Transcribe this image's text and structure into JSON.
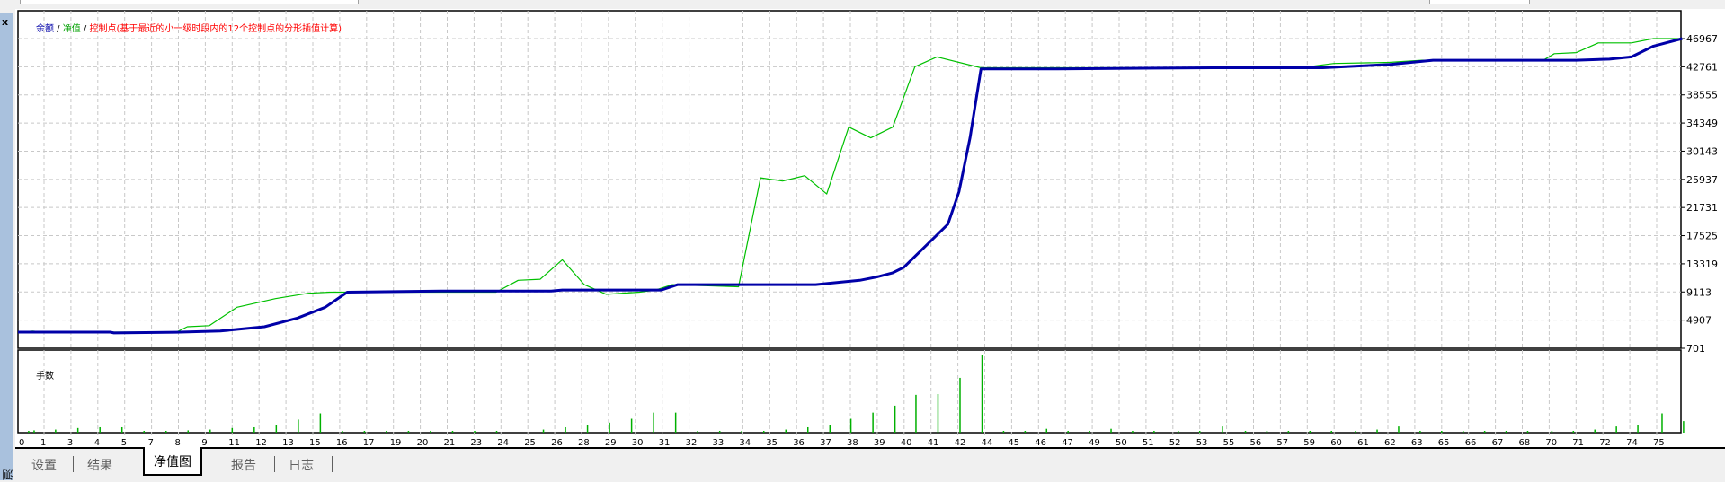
{
  "window": {
    "close_label": "x",
    "panel_label": "测试"
  },
  "legend": {
    "balance": "余额",
    "sep1": " / ",
    "equity": "净值",
    "sep2": " / ",
    "control": "控制点(基于最近的小一级时段内的12个控制点的分形插值计算)"
  },
  "volume_pane": {
    "label": "手数"
  },
  "tabs": [
    {
      "label": "设置"
    },
    {
      "label": "结果"
    },
    {
      "label": "净值图",
      "active": true
    },
    {
      "label": "报告"
    },
    {
      "label": "日志"
    }
  ],
  "colors": {
    "balance": "#0000a8",
    "equity": "#00c000",
    "control": "#ff0000",
    "volume": "#00b000",
    "grid": "#c8c8c8"
  },
  "chart_data": {
    "type": "line",
    "x_unit": "tick index",
    "y_ticks": [
      "46967",
      "42761",
      "38555",
      "34349",
      "30143",
      "25937",
      "21731",
      "17525",
      "13319",
      "9113",
      "4907",
      "701"
    ],
    "ylim": [
      701,
      46967
    ],
    "x_ticks": [
      "0",
      "1",
      "3",
      "4",
      "5",
      "7",
      "8",
      "9",
      "11",
      "12",
      "13",
      "15",
      "16",
      "17",
      "19",
      "20",
      "21",
      "23",
      "24",
      "25",
      "26",
      "28",
      "29",
      "30",
      "31",
      "32",
      "33",
      "34",
      "35",
      "36",
      "37",
      "38",
      "39",
      "40",
      "41",
      "42",
      "44",
      "45",
      "46",
      "47",
      "49",
      "50",
      "51",
      "52",
      "53",
      "55",
      "56",
      "57",
      "59",
      "60",
      "61",
      "62",
      "63",
      "65",
      "66",
      "67",
      "68",
      "70",
      "71",
      "72",
      "74",
      "75"
    ],
    "series": [
      {
        "name": "余额",
        "points": [
          [
            0,
            3119
          ],
          [
            3.46,
            3119
          ],
          [
            3.6,
            2990
          ],
          [
            5.92,
            3100
          ],
          [
            7.56,
            3280
          ],
          [
            9.2,
            3925
          ],
          [
            10.43,
            5215
          ],
          [
            11.46,
            6827
          ],
          [
            12.28,
            9083
          ],
          [
            15.77,
            9245
          ],
          [
            19.87,
            9245
          ],
          [
            20.28,
            9406
          ],
          [
            23.97,
            9406
          ],
          [
            24.58,
            10212
          ],
          [
            27.25,
            10212
          ],
          [
            29.71,
            10212
          ],
          [
            30.12,
            10373
          ],
          [
            31.35,
            10857
          ],
          [
            31.97,
            11340
          ],
          [
            32.58,
            11985
          ],
          [
            32.99,
            12791
          ],
          [
            33.81,
            16015
          ],
          [
            34.63,
            19239
          ],
          [
            35.04,
            24075
          ],
          [
            35.45,
            32135
          ],
          [
            35.86,
            42452
          ],
          [
            38.73,
            42452
          ],
          [
            44.48,
            42613
          ],
          [
            48.58,
            42613
          ],
          [
            51.04,
            43097
          ],
          [
            52.68,
            43741
          ],
          [
            58.01,
            43741
          ],
          [
            59.24,
            43902
          ],
          [
            60.06,
            44225
          ],
          [
            60.88,
            45837
          ],
          [
            61.95,
            46965
          ]
        ]
      },
      {
        "name": "净值",
        "points": [
          [
            0,
            3119
          ],
          [
            0.57,
            3280
          ],
          [
            1,
            3119
          ],
          [
            5.92,
            3119
          ],
          [
            6.33,
            3925
          ],
          [
            7.15,
            4086
          ],
          [
            8.18,
            6827
          ],
          [
            9.61,
            8116
          ],
          [
            10.84,
            8922
          ],
          [
            11.66,
            9083
          ],
          [
            12.28,
            9083
          ],
          [
            17.82,
            9083
          ],
          [
            18.64,
            10857
          ],
          [
            19.46,
            11018
          ],
          [
            20.28,
            13919
          ],
          [
            21.1,
            10212
          ],
          [
            21.92,
            8761
          ],
          [
            23.15,
            9083
          ],
          [
            23.76,
            9406
          ],
          [
            24.38,
            10212
          ],
          [
            26.84,
            9890
          ],
          [
            27.66,
            26170
          ],
          [
            28.48,
            25686
          ],
          [
            29.3,
            26492
          ],
          [
            30.12,
            23752
          ],
          [
            30.94,
            33747
          ],
          [
            31.76,
            32135
          ],
          [
            32.58,
            33747
          ],
          [
            33.4,
            42774
          ],
          [
            34.22,
            44225
          ],
          [
            35.86,
            42613
          ],
          [
            47.76,
            42613
          ],
          [
            48.99,
            43258
          ],
          [
            51.04,
            43419
          ],
          [
            52.27,
            43741
          ],
          [
            56.78,
            43741
          ],
          [
            57.19,
            44709
          ],
          [
            58.01,
            44870
          ],
          [
            58.83,
            46321
          ],
          [
            60.06,
            46321
          ],
          [
            60.88,
            46965
          ],
          [
            61.95,
            46965
          ]
        ]
      }
    ],
    "volume": {
      "name": "手数",
      "relative_bars": [
        [
          0.41,
          0.02
        ],
        [
          0.62,
          0.03
        ],
        [
          1.43,
          0.04
        ],
        [
          2.26,
          0.06
        ],
        [
          3.08,
          0.07
        ],
        [
          3.9,
          0.07
        ],
        [
          4.72,
          0.01
        ],
        [
          5.54,
          0.01
        ],
        [
          6.36,
          0.03
        ],
        [
          7.18,
          0.04
        ],
        [
          8.0,
          0.06
        ],
        [
          8.82,
          0.07
        ],
        [
          9.64,
          0.1
        ],
        [
          10.46,
          0.17
        ],
        [
          11.28,
          0.25
        ],
        [
          12.1,
          0.01
        ],
        [
          12.92,
          0.01
        ],
        [
          13.74,
          0.01
        ],
        [
          14.56,
          0.01
        ],
        [
          15.38,
          0.01
        ],
        [
          16.2,
          0.01
        ],
        [
          17.02,
          0.01
        ],
        [
          17.84,
          0.01
        ],
        [
          19.58,
          0.04
        ],
        [
          20.4,
          0.07
        ],
        [
          21.22,
          0.1
        ],
        [
          22.04,
          0.13
        ],
        [
          22.86,
          0.18
        ],
        [
          23.68,
          0.26
        ],
        [
          24.5,
          0.26
        ],
        [
          25.32,
          0.01
        ],
        [
          26.14,
          0.01
        ],
        [
          26.96,
          0.01
        ],
        [
          27.78,
          0.01
        ],
        [
          28.6,
          0.04
        ],
        [
          29.42,
          0.07
        ],
        [
          30.24,
          0.1
        ],
        [
          31.02,
          0.18
        ],
        [
          31.84,
          0.26
        ],
        [
          32.66,
          0.35
        ],
        [
          33.44,
          0.49
        ],
        [
          34.26,
          0.5
        ],
        [
          35.08,
          0.71
        ],
        [
          35.9,
          1.0
        ],
        [
          36.7,
          0.01
        ],
        [
          37.5,
          0.01
        ],
        [
          38.3,
          0.05
        ],
        [
          39.1,
          0.01
        ],
        [
          39.9,
          0.01
        ],
        [
          40.7,
          0.05
        ],
        [
          41.5,
          0.01
        ],
        [
          42.3,
          0.01
        ],
        [
          43.2,
          0.01
        ],
        [
          44.0,
          0.01
        ],
        [
          44.85,
          0.08
        ],
        [
          45.7,
          0.01
        ],
        [
          46.5,
          0.01
        ],
        [
          47.3,
          0.01
        ],
        [
          48.1,
          0.01
        ],
        [
          48.9,
          0.01
        ],
        [
          49.8,
          0.01
        ],
        [
          50.6,
          0.04
        ],
        [
          51.4,
          0.08
        ],
        [
          52.2,
          0.01
        ],
        [
          53.0,
          0.01
        ],
        [
          53.8,
          0.01
        ],
        [
          54.6,
          0.01
        ],
        [
          55.4,
          0.01
        ],
        [
          56.2,
          0.01
        ],
        [
          57.1,
          0.01
        ],
        [
          57.9,
          0.01
        ],
        [
          58.7,
          0.04
        ],
        [
          59.5,
          0.08
        ],
        [
          60.3,
          0.1
        ],
        [
          61.2,
          0.25
        ],
        [
          62.0,
          0.15
        ]
      ]
    }
  }
}
